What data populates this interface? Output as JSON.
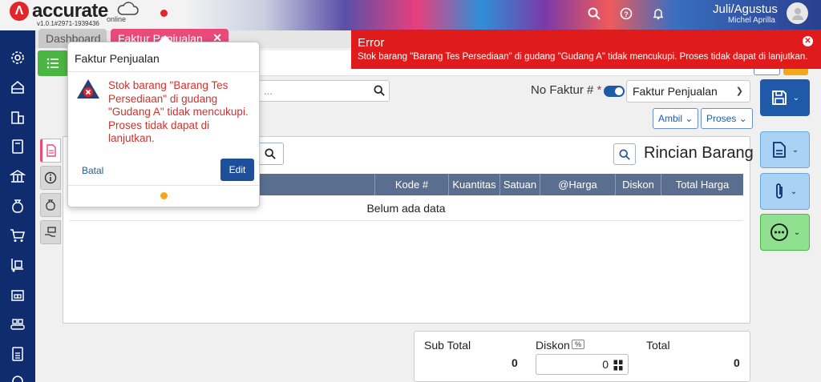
{
  "app": {
    "logo_text": "accurate",
    "logo_sub": "online",
    "version": "v1.0.1#2971-1939436",
    "user_period": "Juli/Agustus",
    "user_name": "Michel Aprilla"
  },
  "topbar_icons": [
    "search-icon",
    "help-icon",
    "bell-icon"
  ],
  "sidebar_icons": [
    "gear-icon",
    "inbox-icon",
    "building-icon",
    "ledger-icon",
    "bank-icon",
    "money-bag-icon",
    "cart-icon",
    "dolly-icon",
    "warehouse-icon",
    "conveyor-icon",
    "tax-icon",
    "settings-icon"
  ],
  "tabs": [
    {
      "label": "Dashboard"
    },
    {
      "label": "Faktur Penjualan",
      "close": "✕"
    }
  ],
  "form": {
    "search_placeholder": "...",
    "no_faktur_label": "No Faktur #",
    "required_mark": "*",
    "type_select": "Faktur Penjualan",
    "ambil_label": "Ambil",
    "proses_label": "Proses"
  },
  "items": {
    "section_title": "Rincian Barang",
    "columns": [
      "Kode #",
      "Kuantitas",
      "Satuan",
      "@Harga",
      "Diskon",
      "Total Harga"
    ],
    "empty_text": "Belum ada data"
  },
  "totals": {
    "sub_total_label": "Sub Total",
    "sub_total_value": "0",
    "diskon_label": "Diskon",
    "diskon_unit": "%",
    "diskon_value": "0",
    "total_label": "Total",
    "total_value": "0"
  },
  "error_banner": {
    "title": "Error",
    "message": "Stok barang \"Barang Tes Persediaan\" di gudang \"Gudang A\" tidak mencukupi. Proses tidak dapat di lanjutkan."
  },
  "popup": {
    "title": "Faktur Penjualan",
    "message": "Stok barang \"Barang Tes Persediaan\" di gudang \"Gudang A\" tidak mencukupi. Proses tidak dapat di lanjutkan.",
    "cancel_label": "Batal",
    "edit_label": "Edit"
  },
  "colors": {
    "brand_red": "#e0252b",
    "sidebar_navy": "#0f2d6e",
    "tab_pink": "#e94a7a",
    "primary_blue": "#1e5aa8",
    "error_red": "#e01b1b",
    "save_button": "#1e5aa8",
    "more_button_green": "#8fe08f"
  }
}
